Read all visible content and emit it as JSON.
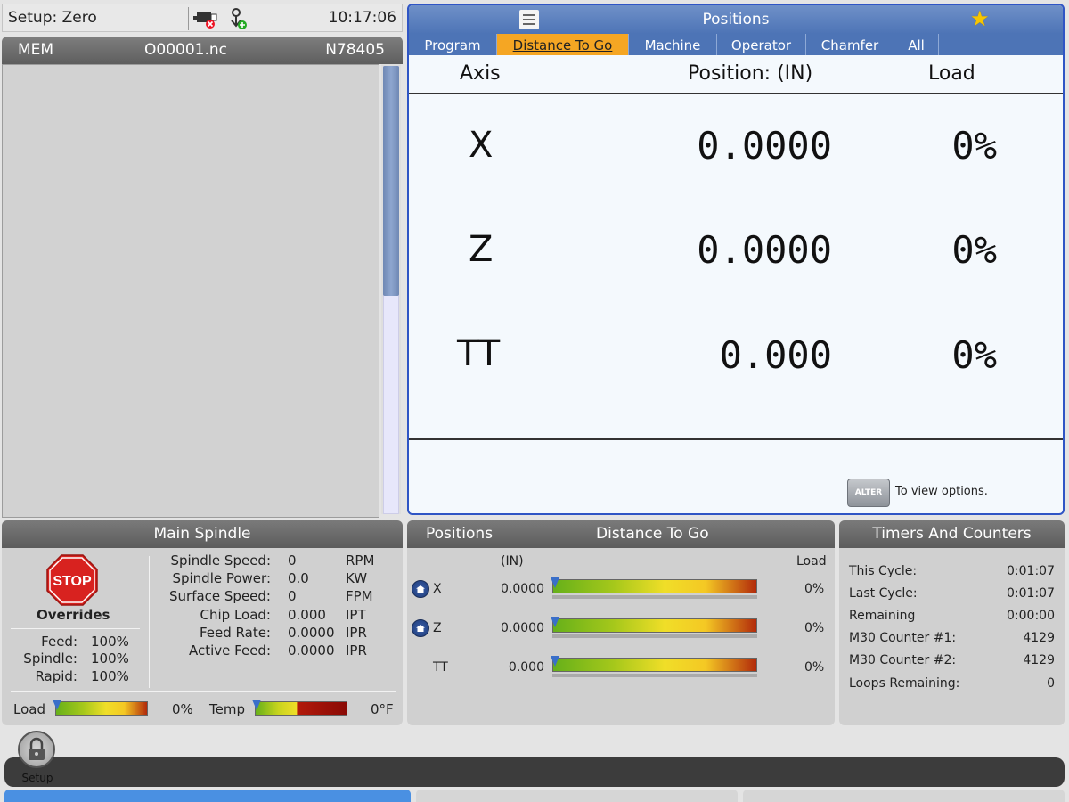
{
  "status": {
    "mode": "Setup: Zero",
    "time": "10:17:06"
  },
  "program": {
    "device": "MEM",
    "file": "O00001.nc",
    "block": "N78405"
  },
  "positions_panel": {
    "title": "Positions",
    "tabs": [
      "Program",
      "Distance To Go",
      "Machine",
      "Operator",
      "Chamfer",
      "All"
    ],
    "active_tab": "Distance To Go",
    "col_axis": "Axis",
    "col_position": "Position:  (IN)",
    "col_load": "Load",
    "rows": [
      {
        "axis": "X",
        "value": "0.0000",
        "load": "0%"
      },
      {
        "axis": "Z",
        "value": "0.0000",
        "load": "0%"
      },
      {
        "axis": "TT",
        "value": "0.000",
        "load": "0%"
      }
    ],
    "alter_button": "ALTER",
    "alter_hint": "To view options."
  },
  "spindle": {
    "title": "Main Spindle",
    "stop_label": "STOP",
    "overrides_label": "Overrides",
    "overrides": [
      {
        "label": "Feed:",
        "value": "100%"
      },
      {
        "label": "Spindle:",
        "value": "100%"
      },
      {
        "label": "Rapid:",
        "value": "100%"
      }
    ],
    "readouts": [
      {
        "label": "Spindle Speed:",
        "value": "0",
        "unit": "RPM"
      },
      {
        "label": "Spindle Power:",
        "value": "0.0",
        "unit": "KW"
      },
      {
        "label": "Surface Speed:",
        "value": "0",
        "unit": "FPM"
      },
      {
        "label": "Chip Load:",
        "value": "0.000",
        "unit": "IPT"
      },
      {
        "label": "Feed Rate:",
        "value": "0.0000",
        "unit": "IPR"
      },
      {
        "label": "Active Feed:",
        "value": "0.0000",
        "unit": "IPR"
      }
    ],
    "load_label": "Load",
    "load_value": "0%",
    "load_level": 0,
    "temp_label": "Temp",
    "temp_value": "0°F",
    "temp_level": 0
  },
  "dtg_panel": {
    "title_left": "Positions",
    "title_right": "Distance To Go",
    "unit_label": "(IN)",
    "load_label": "Load",
    "rows": [
      {
        "axis": "X",
        "value": "0.0000",
        "load": "0%",
        "home": true,
        "load_level": 0
      },
      {
        "axis": "Z",
        "value": "0.0000",
        "load": "0%",
        "home": true,
        "load_level": 0
      },
      {
        "axis": "TT",
        "value": "0.000",
        "load": "0%",
        "home": false,
        "load_level": 0
      }
    ]
  },
  "timers": {
    "title": "Timers And Counters",
    "rows": [
      {
        "label": "This Cycle:",
        "value": "0:01:07"
      },
      {
        "label": "Last Cycle:",
        "value": "0:01:07"
      },
      {
        "label": "Remaining",
        "value": "0:00:00"
      },
      {
        "label": "M30 Counter #1:",
        "value": "4129"
      },
      {
        "label": "M30 Counter #2:",
        "value": "4129"
      },
      {
        "label": "Loops Remaining:",
        "value": "0"
      }
    ]
  },
  "bottom": {
    "setup_label": "Setup"
  },
  "colors": {
    "accent_blue": "#4d74b6",
    "active_tab": "#f5a623",
    "stop_red": "#d8221f"
  },
  "icons": [
    "menu-icon",
    "star-icon",
    "stop-sign-icon",
    "home-icon",
    "lock-icon",
    "memory-card-icon",
    "handle-jog-icon"
  ]
}
